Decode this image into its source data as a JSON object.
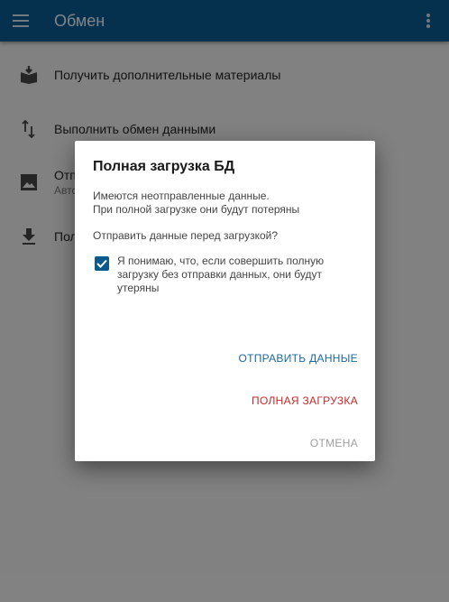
{
  "appbar": {
    "title": "Обмен",
    "menu_icon": "hamburger-menu-icon",
    "more_icon": "more-vert-icon",
    "color": "#0b5a8e"
  },
  "list": {
    "items": [
      {
        "label": "Получить дополнительные материалы",
        "icon": "book-download-icon"
      },
      {
        "label": "Выполнить обмен данными",
        "icon": "sync-arrows-icon"
      },
      {
        "label": "Отп",
        "sublabel": "Авто",
        "icon": "image-icon"
      },
      {
        "label": "Пол",
        "icon": "download-icon"
      }
    ]
  },
  "dialog": {
    "title": "Полная загрузка БД",
    "message_line1": "Имеются неотправленные данные.",
    "message_line2": "При полной загрузке они будут потеряны",
    "question": "Отправить данные перед загрузкой?",
    "checkbox_label": "Я понимаю, что, если совершить полную загрузку без отправки данных, они будут утеряны",
    "checkbox_checked": true,
    "send_button": "ОТПРАВИТЬ ДАННЫЕ",
    "full_load_button": "ПОЛНАЯ ЗАГРУЗКА",
    "cancel_button": "ОТМЕНА",
    "colors": {
      "send": "#1b6aa0",
      "full_load": "#c62828",
      "cancel": "#9e9e9e",
      "checkbox": "#0b5a8e"
    }
  }
}
